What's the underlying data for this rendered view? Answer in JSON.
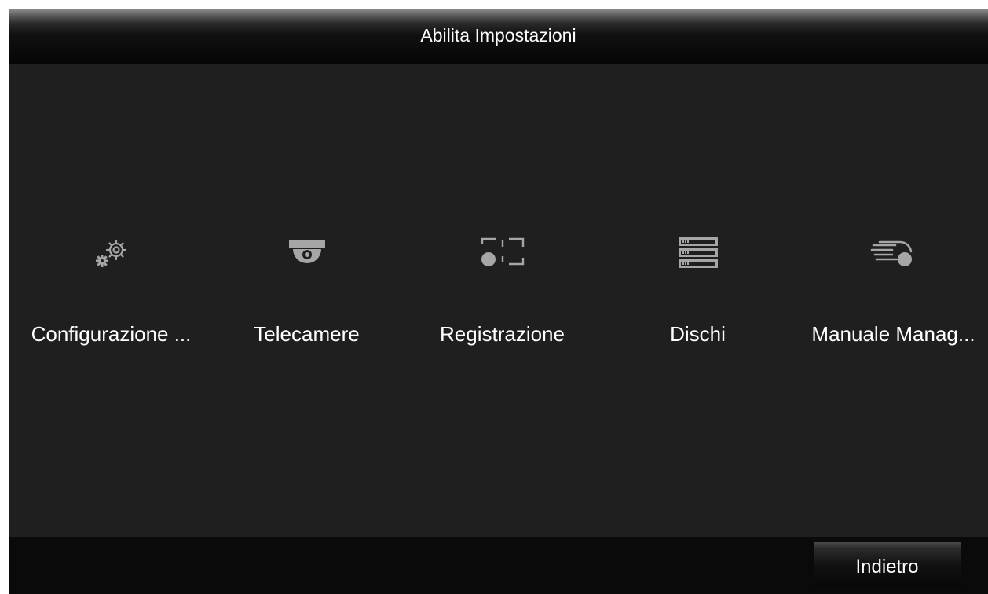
{
  "window": {
    "title": "Abilita Impostazioni"
  },
  "menu": {
    "items": [
      {
        "label": "Configurazione ...",
        "icon": "gears-icon"
      },
      {
        "label": "Telecamere",
        "icon": "dome-camera-icon"
      },
      {
        "label": "Registrazione",
        "icon": "record-icon"
      },
      {
        "label": "Dischi",
        "icon": "storage-disk-icon"
      },
      {
        "label": "Manuale Manag...",
        "icon": "manual-record-icon"
      }
    ]
  },
  "footer": {
    "back_label": "Indietro"
  },
  "colors": {
    "background": "#1f1f20",
    "icon": "#a6a6a6",
    "text": "#ffffff",
    "footer": "#0a0a0a"
  }
}
